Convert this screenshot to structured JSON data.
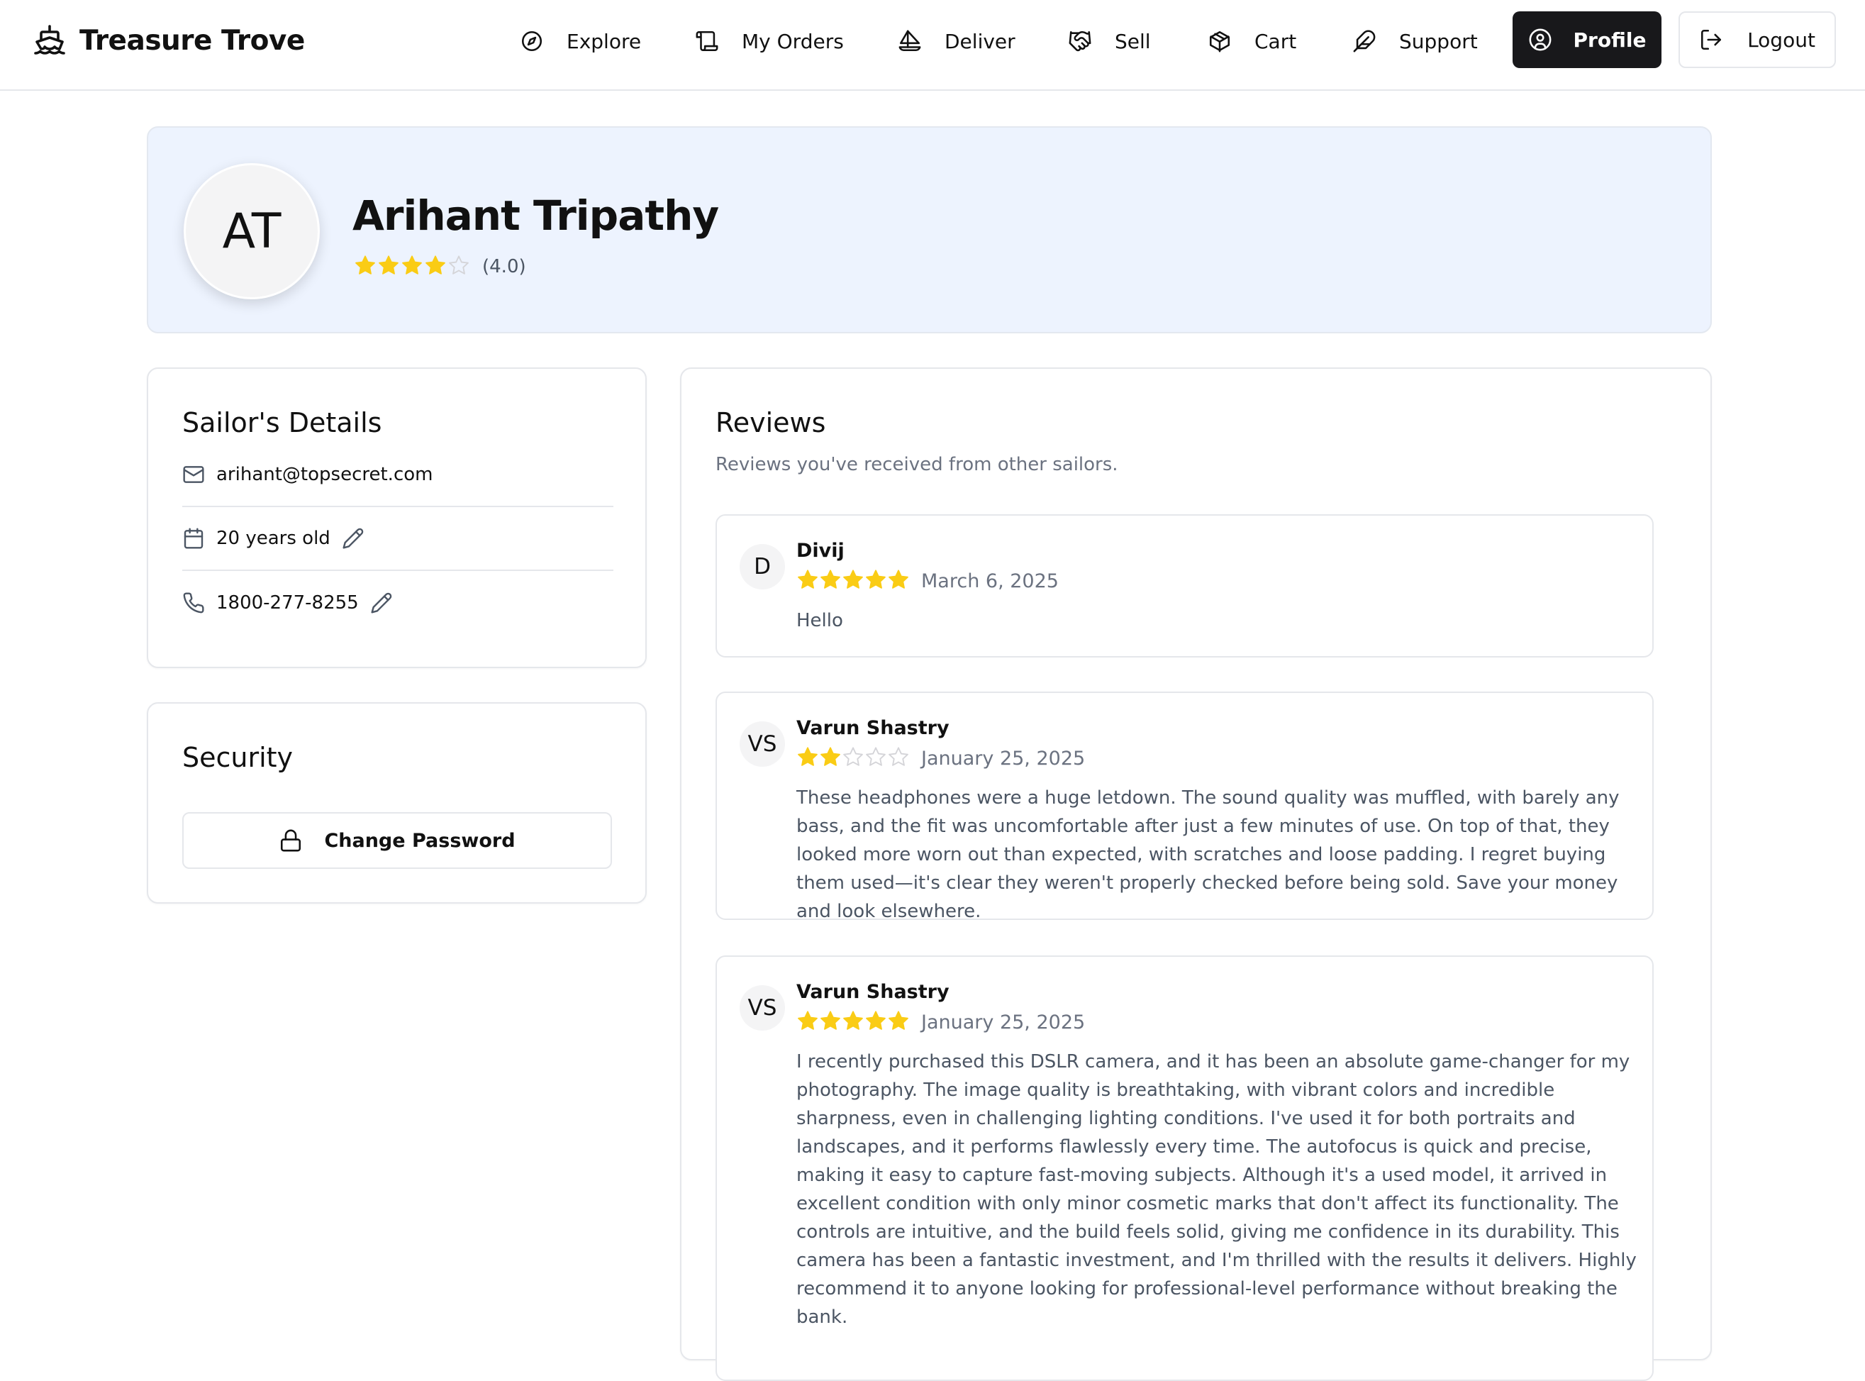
{
  "brand": {
    "name": "Treasure Trove",
    "icon": "ship-icon"
  },
  "nav": {
    "items": [
      {
        "label": "Explore",
        "icon": "compass-icon"
      },
      {
        "label": "My Orders",
        "icon": "scroll-icon"
      },
      {
        "label": "Deliver",
        "icon": "sailboat-icon"
      },
      {
        "label": "Sell",
        "icon": "handshake-icon"
      },
      {
        "label": "Cart",
        "icon": "package-icon"
      },
      {
        "label": "Support",
        "icon": "feather-icon"
      }
    ],
    "profile_label": "Profile",
    "logout_label": "Logout"
  },
  "profile": {
    "initials": "AT",
    "name": "Arihant Tripathy",
    "rating": 4,
    "rating_text": "(4.0)"
  },
  "details": {
    "title": "Sailor's Details",
    "email": "arihant@topsecret.com",
    "age": "20 years old",
    "phone": "1800-277-8255"
  },
  "security": {
    "title": "Security",
    "change_password_label": "Change Password"
  },
  "reviews": {
    "title": "Reviews",
    "subtitle": "Reviews you've received from other sailors.",
    "items": [
      {
        "initials": "D",
        "name": "Divij",
        "rating": 5,
        "date": "March 6, 2025",
        "text": "Hello"
      },
      {
        "initials": "VS",
        "name": "Varun Shastry",
        "rating": 2,
        "date": "January 25, 2025",
        "text": "These headphones were a huge letdown. The sound quality was muffled, with barely any bass, and the fit was uncomfortable after just a few minutes of use. On top of that, they looked more worn out than expected, with scratches and loose padding. I regret buying them used—it's clear they weren't properly checked before being sold. Save your money and look elsewhere."
      },
      {
        "initials": "VS",
        "name": "Varun Shastry",
        "rating": 5,
        "date": "January 25, 2025",
        "text": "I recently purchased this DSLR camera, and it has been an absolute game-changer for my photography. The image quality is breathtaking, with vibrant colors and incredible sharpness, even in challenging lighting conditions. I've used it for both portraits and landscapes, and it performs flawlessly every time. The autofocus is quick and precise, making it easy to capture fast-moving subjects. Although it's a used model, it arrived in excellent condition with only minor cosmetic marks that don't affect its functionality. The controls are intuitive, and the build feels solid, giving me confidence in its durability. This camera has been a fantastic investment, and I'm thrilled with the results it delivers. Highly recommend it to anyone looking for professional-level performance without breaking the bank."
      }
    ]
  },
  "colors": {
    "primary_button": "#18181b",
    "hero_background": "#edf3fe",
    "star_filled": "#facc15",
    "star_empty": "#d4d4d8",
    "muted_text": "#6b7280"
  }
}
